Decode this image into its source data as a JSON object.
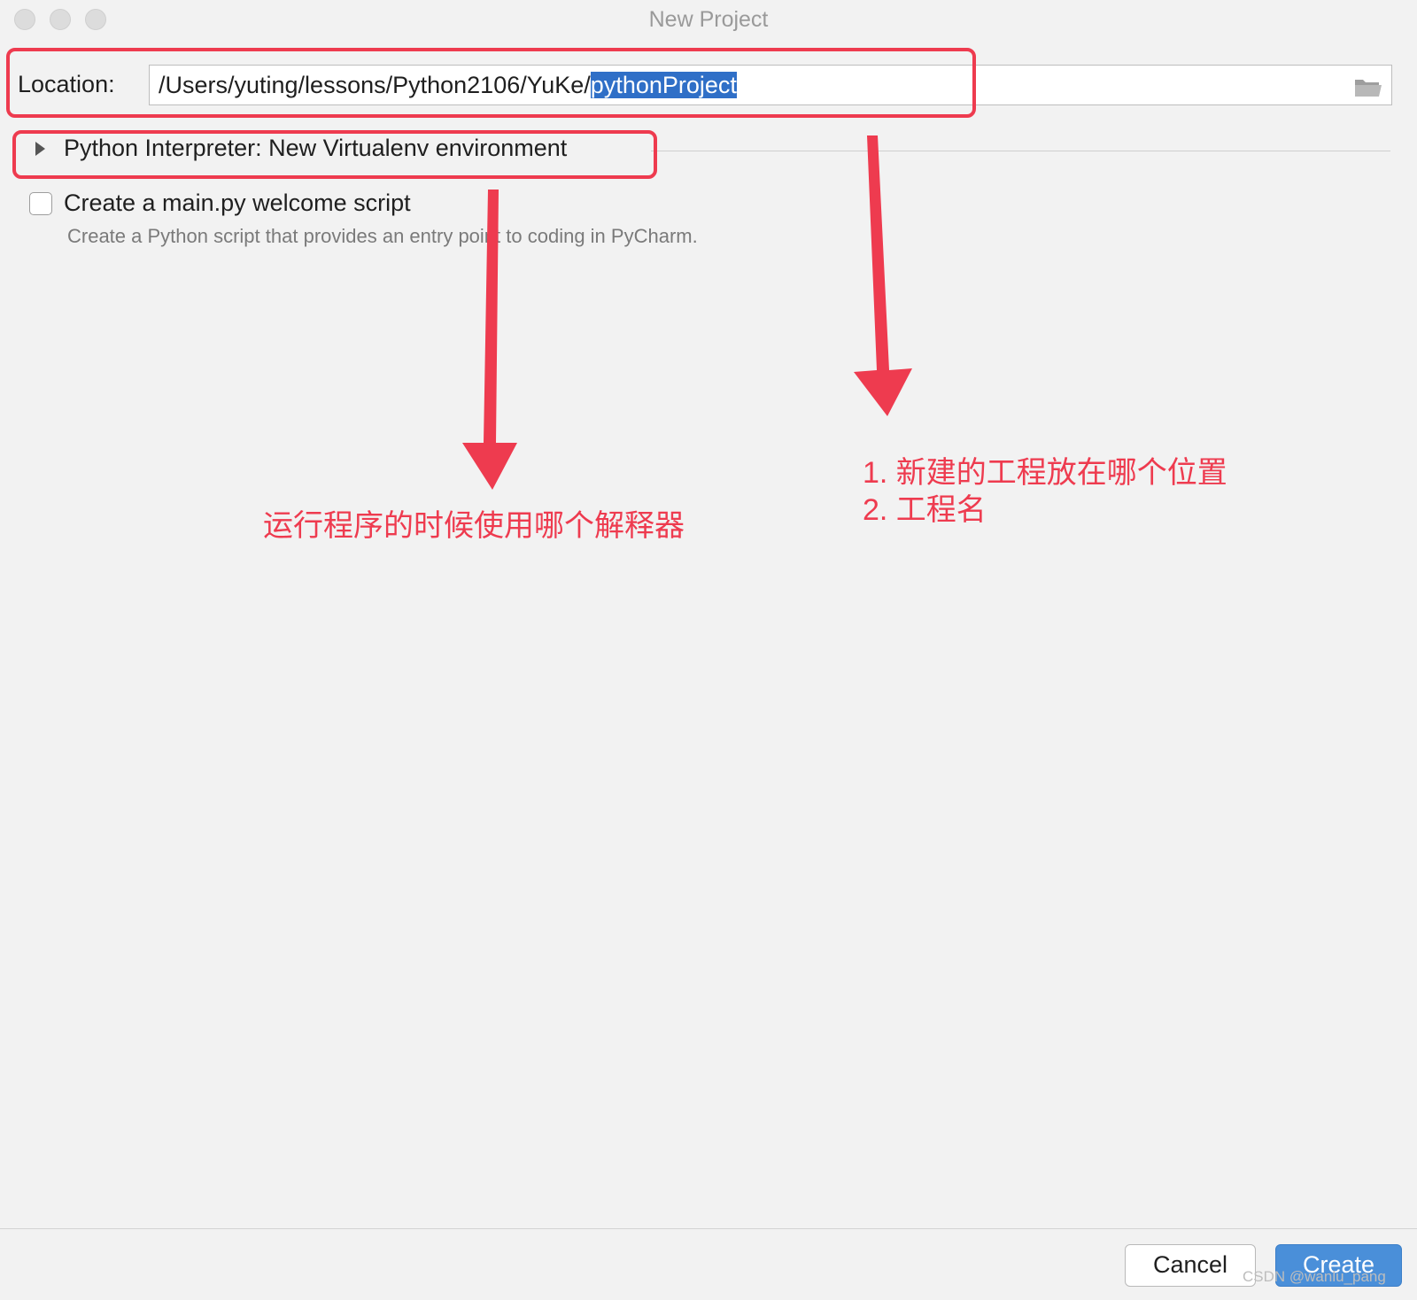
{
  "window": {
    "title": "New Project"
  },
  "location": {
    "label": "Location:",
    "path_prefix": "/Users/yuting/lessons/Python2106/YuKe/",
    "project_name": "pythonProject"
  },
  "interpreter": {
    "label": "Python Interpreter: New Virtualenv environment"
  },
  "welcome_script": {
    "label": "Create a main.py welcome script",
    "description": "Create a Python script that provides an entry point to coding in PyCharm."
  },
  "annotations": {
    "interpreter_note": "运行程序的时候使用哪个解释器",
    "location_note_1": "1. 新建的工程放在哪个位置",
    "location_note_2": "2. 工程名",
    "color": "#ee3b4f"
  },
  "buttons": {
    "cancel": "Cancel",
    "create": "Create"
  },
  "watermark": "CSDN @wanlu_pang",
  "icons": {
    "folder": "folder-icon",
    "expand": "triangle-right-icon"
  },
  "colors": {
    "accent": "#4a8fd9",
    "selection": "#2f6fc7",
    "annotation": "#ee3b4f"
  }
}
